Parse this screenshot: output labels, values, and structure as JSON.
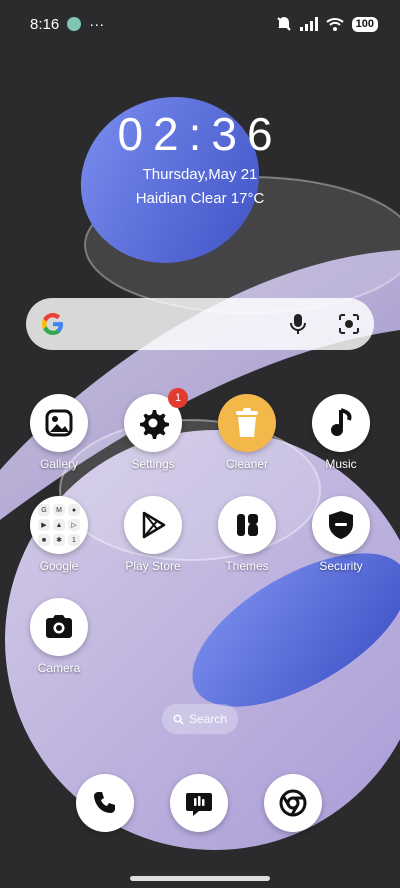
{
  "status": {
    "time": "8:16",
    "more": "···",
    "battery": "100"
  },
  "clock": {
    "time": "02:36",
    "date": "Thursday,May 21",
    "weather": "Haidian Clear 17°C"
  },
  "apps": [
    {
      "label": "Gallery",
      "icon": "gallery-icon"
    },
    {
      "label": "Settings",
      "icon": "gear-icon",
      "badge": "1"
    },
    {
      "label": "Cleaner",
      "icon": "trash-icon"
    },
    {
      "label": "Music",
      "icon": "music-note-icon"
    },
    {
      "label": "Google",
      "icon": "folder-icon"
    },
    {
      "label": "Play Store",
      "icon": "play-store-icon"
    },
    {
      "label": "Themes",
      "icon": "themes-icon"
    },
    {
      "label": "Security",
      "icon": "shield-icon"
    },
    {
      "label": "Camera",
      "icon": "camera-icon"
    }
  ],
  "search_pill": {
    "label": "Search"
  },
  "dock": [
    {
      "icon": "phone-icon"
    },
    {
      "icon": "messages-icon"
    },
    {
      "icon": "chrome-icon"
    }
  ],
  "colors": {
    "background": "#2b2b2d",
    "wallpaper_blue": "#5b6fd6",
    "wallpaper_lavender": "#c9bdf0",
    "cleaner_orange": "#f4b84a",
    "badge_red": "#e33b2f"
  }
}
